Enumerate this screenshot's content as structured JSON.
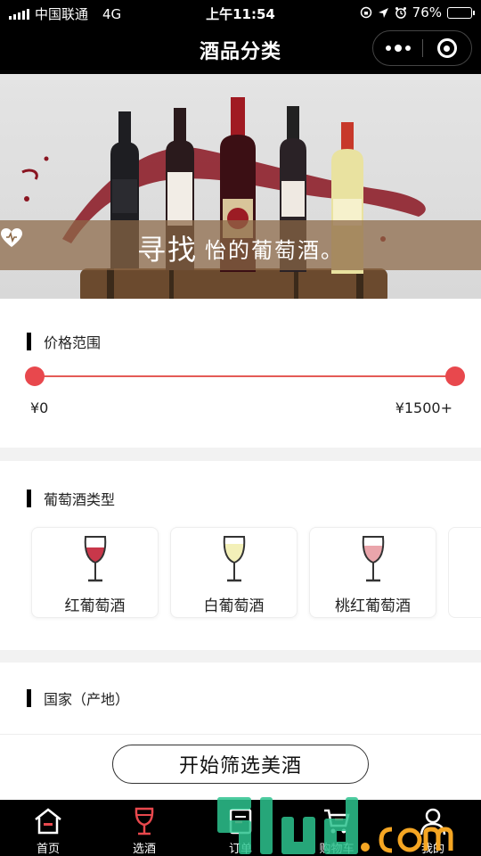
{
  "status_bar": {
    "carrier": "中国联通",
    "network": "4G",
    "time": "上午11:54",
    "battery": "76%",
    "battery_level": 0.76
  },
  "nav": {
    "title": "酒品分类"
  },
  "banner": {
    "text_part1": "寻找",
    "text_part2": "怡的葡萄酒。"
  },
  "price_section": {
    "title": "价格范围",
    "min_label": "¥0",
    "max_label": "¥1500+"
  },
  "type_section": {
    "title": "葡萄酒类型",
    "types": [
      {
        "label": "红葡萄酒",
        "wine_color": "#c8374a"
      },
      {
        "label": "白葡萄酒",
        "wine_color": "#f3f0b8"
      },
      {
        "label": "桃红葡萄酒",
        "wine_color": "#eaa5ab"
      }
    ]
  },
  "country_section": {
    "title": "国家（产地）"
  },
  "filter_button": {
    "label": "开始筛选美酒"
  },
  "tabbar": {
    "tabs": [
      {
        "label": "首页",
        "icon": "home-icon"
      },
      {
        "label": "选酒",
        "icon": "wine-glass-icon",
        "active": true
      },
      {
        "label": "订单",
        "icon": "order-icon"
      },
      {
        "label": "购物车",
        "icon": "cart-icon"
      },
      {
        "label": "我的",
        "icon": "user-icon"
      }
    ]
  },
  "colors": {
    "accent": "#e8484d",
    "bar_background": "#000000",
    "banner_band": "#8c6846"
  }
}
